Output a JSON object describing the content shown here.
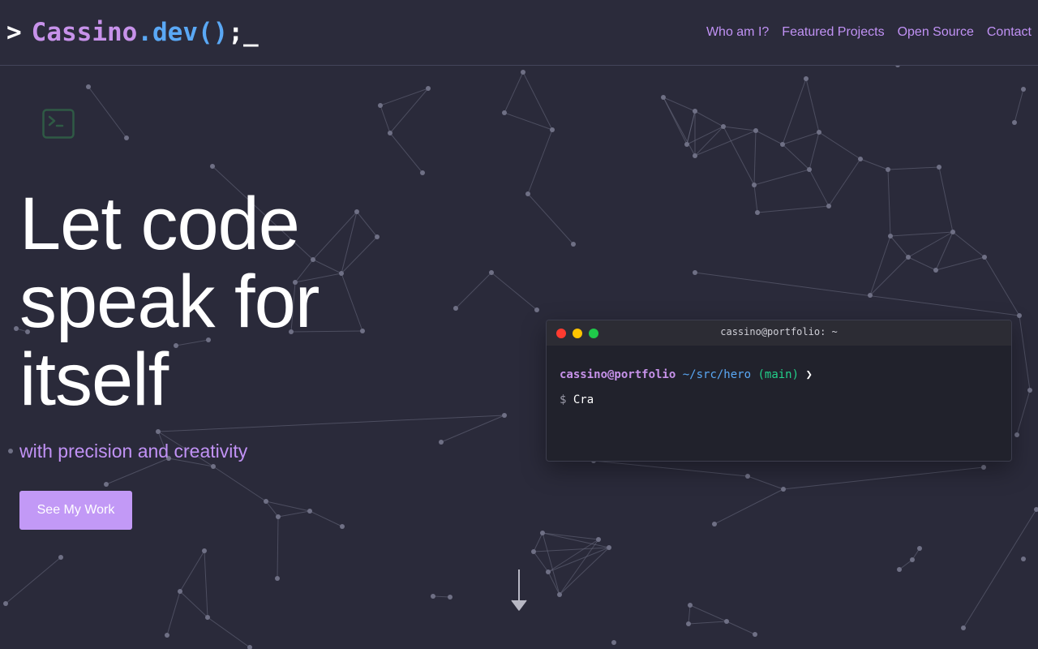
{
  "nav": {
    "logo_prompt": ">",
    "logo_name": "Cassino",
    "logo_tld": ".dev()",
    "logo_semi": ";",
    "logo_cursor": "_",
    "links": [
      "Who am I?",
      "Featured Projects",
      "Open Source",
      "Contact"
    ]
  },
  "hero": {
    "title_lines": [
      "Let code",
      "speak for",
      "itself"
    ],
    "subtitle": "with precision and creativity",
    "cta_label": "See My Work"
  },
  "terminal": {
    "title": "cassino@portfolio: ~",
    "user": "cassino@portfolio",
    "path": "~/src/hero",
    "branch": "(main)",
    "chevron": "❯",
    "dollar": "$",
    "command": "Cra"
  },
  "colors": {
    "background": "#2a2a3a",
    "accent": "#c192f5",
    "logo_blue": "#5aa8f5",
    "button": "#c299f6",
    "terminal_bg": "#21222c"
  },
  "icons": [
    "terminal-icon",
    "arrow-down-icon"
  ]
}
